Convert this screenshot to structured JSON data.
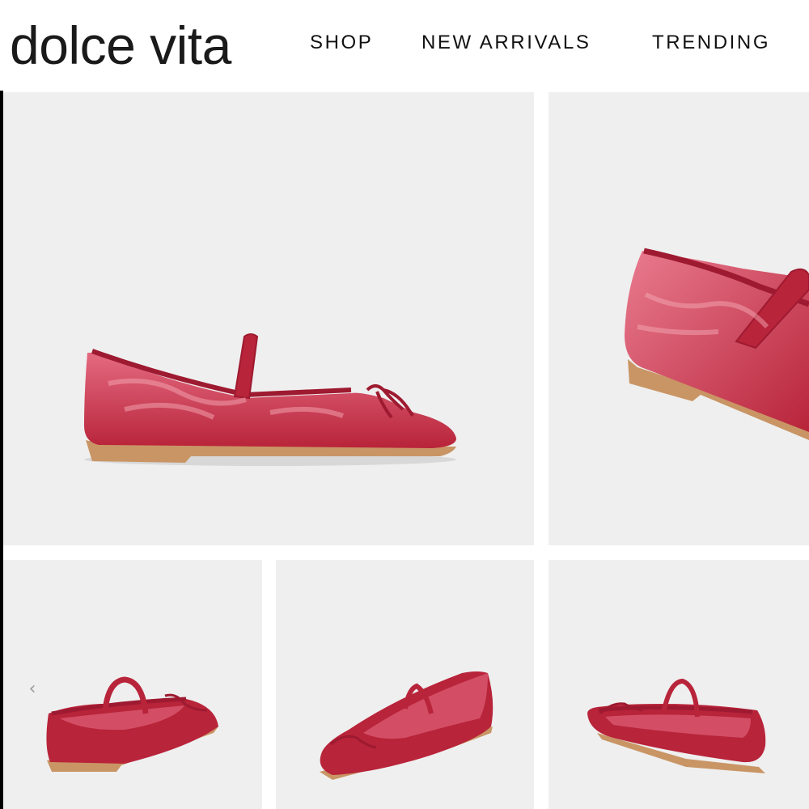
{
  "brand": {
    "logo_text": "dolce vita"
  },
  "nav": {
    "items": [
      {
        "label": "SHOP"
      },
      {
        "label": "NEW ARRIVALS"
      },
      {
        "label": "TRENDING"
      }
    ]
  },
  "gallery": {
    "prev_arrow_glyph": "‹",
    "tile_background": "#efefef",
    "shoe_color": "#b8243a",
    "sole_color": "#c99565",
    "images": [
      {
        "view": "side"
      },
      {
        "view": "heel-closeup"
      },
      {
        "view": "inside"
      },
      {
        "view": "top-front"
      },
      {
        "view": "rear-three-quarter"
      }
    ]
  },
  "colors": {
    "text": "#111111",
    "background": "#ffffff",
    "accent_shoe": "#b8243a"
  }
}
